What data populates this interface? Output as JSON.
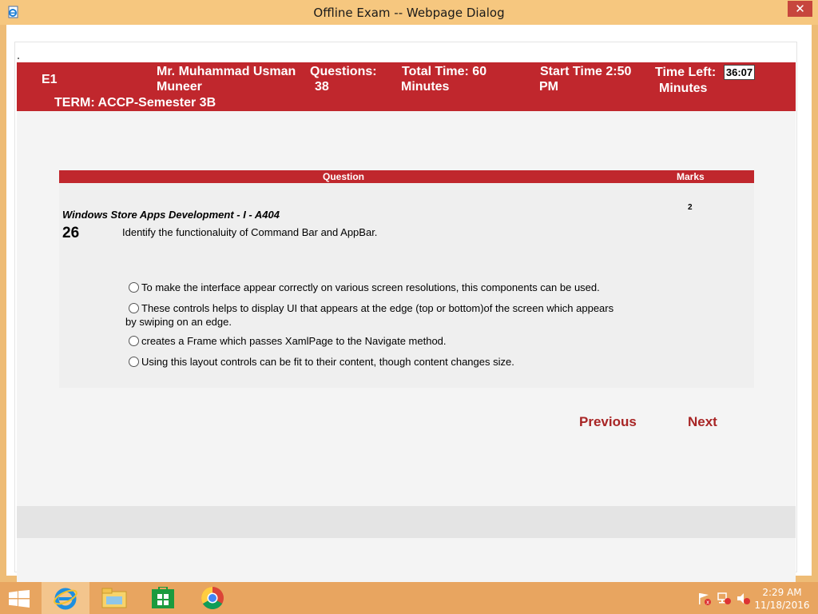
{
  "window": {
    "title": "Offline Exam -- Webpage Dialog",
    "close_glyph": "✕"
  },
  "header": {
    "code": "E1",
    "name_line1": "Mr. Muhammad Usman",
    "name_line2": "Muneer",
    "term": "TERM: ACCP-Semester 3B",
    "questions_label": "Questions:",
    "questions_value": "38",
    "total_time_label": "Total Time:  60",
    "total_time_unit": "Minutes",
    "start_time_label": "Start Time  2:50",
    "start_time_suffix": "PM",
    "time_left_label": "Time Left:",
    "time_left_unit": "Minutes",
    "timer": "36:07"
  },
  "table": {
    "col_question": "Question",
    "col_marks": "Marks",
    "subject": "Windows Store Apps Development - I - A404",
    "question_number": "26",
    "question_text": "Identify the functionaluity of Command Bar and AppBar.",
    "marks": "2",
    "options": [
      "To make the interface appear correctly on various screen resolutions, this components can be used.",
      "These controls helps to display UI that appears at the edge (top or bottom)of the screen which appears by swiping on an edge.",
      "creates a Frame which passes XamlPage to the Navigate method.",
      "Using this layout controls can be fit to their content, though content changes size."
    ]
  },
  "nav": {
    "previous": "Previous",
    "next": "Next"
  },
  "taskbar": {
    "items": [
      "windows-start-icon",
      "internet-explorer-icon",
      "file-explorer-icon",
      "store-icon",
      "chrome-icon"
    ],
    "time": "2:29 AM",
    "date": "11/18/2016"
  },
  "colors": {
    "accent": "#c0272d",
    "link": "#a82525",
    "taskbar": "#e8a560",
    "titlebar": "#f6c77f"
  }
}
